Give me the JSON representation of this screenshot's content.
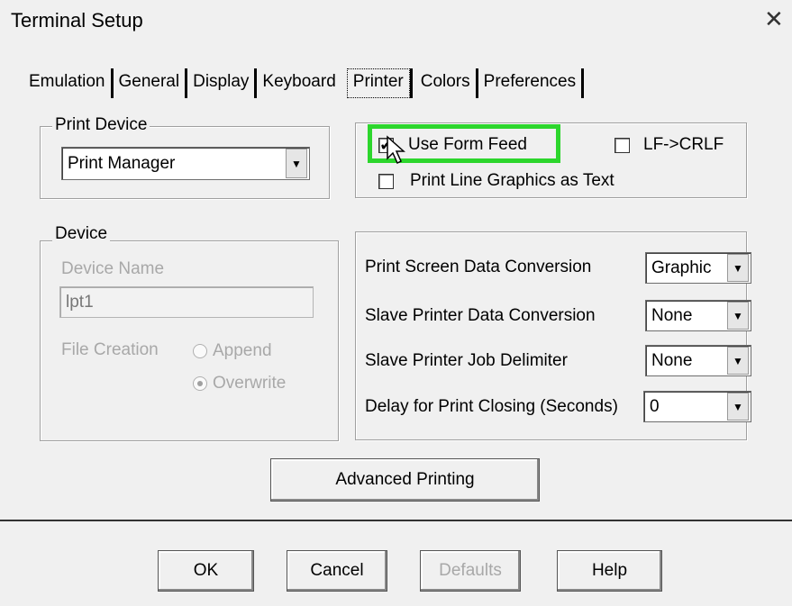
{
  "window": {
    "title": "Terminal Setup",
    "close_glyph": "✕"
  },
  "tabs": [
    {
      "label": "Emulation",
      "active": false
    },
    {
      "label": "General",
      "active": false
    },
    {
      "label": "Display",
      "active": false
    },
    {
      "label": "Keyboard",
      "active": false
    },
    {
      "label": "Printer",
      "active": true
    },
    {
      "label": "Colors",
      "active": false
    },
    {
      "label": "Preferences",
      "active": false
    }
  ],
  "print_device": {
    "legend": "Print Device",
    "selected": "Print Manager"
  },
  "options": {
    "use_form_feed": {
      "label": "Use Form Feed",
      "checked": true
    },
    "lf_crlf": {
      "label": "LF->CRLF",
      "checked": false
    },
    "print_line_graphics": {
      "label": "Print Line Graphics as Text",
      "checked": false
    },
    "highlight_color": "#2cd62c"
  },
  "device": {
    "legend": "Device",
    "name_label": "Device Name",
    "name_value": "lpt1",
    "file_creation_label": "File Creation",
    "append_label": "Append",
    "overwrite_label": "Overwrite",
    "selected_mode": "Overwrite"
  },
  "conversion": {
    "print_screen_label": "Print Screen Data Conversion",
    "print_screen_value": "Graphic",
    "slave_conv_label": "Slave Printer Data Conversion",
    "slave_conv_value": "None",
    "slave_job_label": "Slave Printer Job Delimiter",
    "slave_job_value": "None",
    "delay_label": "Delay for Print Closing (Seconds)",
    "delay_value": "0"
  },
  "advanced_button": "Advanced Printing",
  "footer": {
    "ok": "OK",
    "cancel": "Cancel",
    "defaults": "Defaults",
    "help": "Help"
  }
}
